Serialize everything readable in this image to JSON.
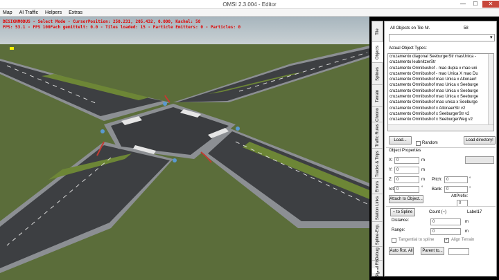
{
  "window": {
    "title": "OMSI 2.3.004 - Editor",
    "minimize": "—",
    "maximize": "☐",
    "close": "✕"
  },
  "menu": [
    "Map",
    "AI Traffic",
    "Helpers",
    "Extras"
  ],
  "debug": {
    "line1": "DESIGNMODUS - Select Mode - CursorPosition: 250.231, 205.432, 0.000, Kachel: 58",
    "line2": "FPS: 53.1 - FPS 100Fach gemittelt: 0.0 - Tiles loaded: 15 - Particle Emitters: 0 - Particles: 0"
  },
  "tabs": [
    "Tile",
    "Objects",
    "Splines",
    "Terrain",
    "Chrono",
    "Traffic Rules",
    "Tracks & Trips",
    "Errors",
    "Station Links",
    "Spline-Exp.",
    "Debug",
    "Signal Rts"
  ],
  "panel": {
    "all_objects_label": "All Objects on Tile Nr.",
    "tile_nr": "58",
    "actual_types_label": "Actual Object Types:",
    "list_items": [
      "cruzamento diagonal SeeburgerStr masUnica -",
      "cruzamento leubnitzerStr",
      "cruzamento Omnibushof - mao dupla x mao uni",
      "cruzamento Omnibushof - mao Unica X mao Du",
      "cruzamento Omnibushof mao Unica x Altonaer!",
      "cruzamento Omnibushof mao Unica x Seeburge",
      "cruzamento Omnibushof mao Unica x Seeburge",
      "cruzamento Omnibushof mao Unica x Seeburge",
      "cruzamento Omnibushof mao unica x Seeburge",
      "cruzamento Omnibushof x AltonaerStr v2",
      "cruzamento Omnibushof x SeeburgerStr v2",
      "cruzamento Omnibushof x SeeburgerWeg v2"
    ],
    "load_btn": "Load...",
    "random_label": "Random",
    "load_dir_btn": "Load directory!",
    "obj_props_label": "Object Properties",
    "x_label": "X:",
    "x_val": "0",
    "y_label": "Y:",
    "y_val": "0",
    "z_label": "Z:",
    "z_val": "0",
    "unit_m": "m",
    "unit_deg": "°",
    "pitch_label": "Pitch:",
    "pitch_val": "0",
    "bank_label": "Bank:",
    "bank_val": "0",
    "rot_label": "rot:",
    "rot_val": "0",
    "attach_btn": "Attach to Object...",
    "attprefix_label": "AttPrefix:",
    "attprefix_val": "0",
    "to_spline_btn": "~ to Spline ...",
    "count_label": "Count (~)",
    "label17": "Label17",
    "distance_label": "Distance:",
    "distance_val": "0",
    "range_label": "Range:",
    "range_val": "0",
    "tangential_label": "Tangential to spline",
    "align_label": "Align Terrain",
    "auto_rot_btn": "Auto Rot. All",
    "parent_btn": "Parent to..."
  },
  "colors": {
    "terrain": "#5b6d3a",
    "asphalt": "#3d3f42",
    "debug_text": "#e00000"
  }
}
